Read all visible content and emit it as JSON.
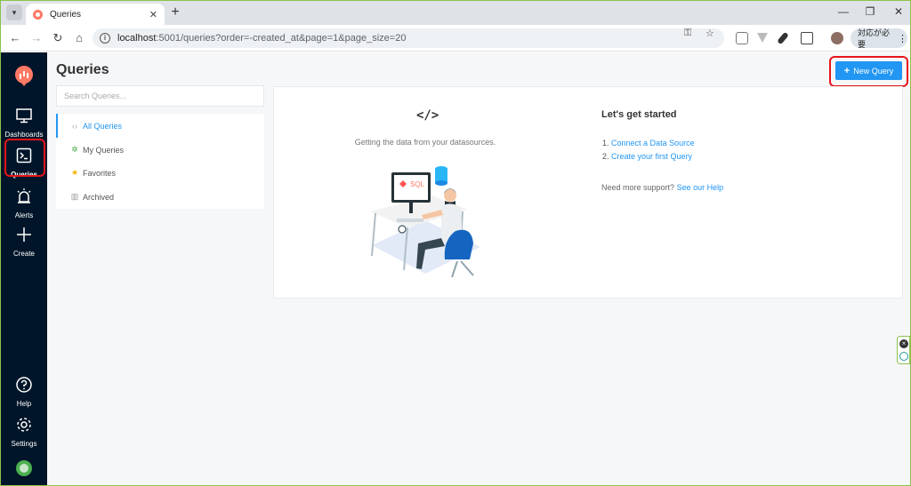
{
  "browser": {
    "tab_title": "Queries",
    "url_host": "localhost",
    "url_path": ":5001/queries?order=-created_at&page=1&page_size=20",
    "profile_label": "対応が必要"
  },
  "nav": {
    "items": [
      {
        "label": "Dashboards"
      },
      {
        "label": "Queries"
      },
      {
        "label": "Alerts"
      },
      {
        "label": "Create"
      },
      {
        "label": "Help"
      },
      {
        "label": "Settings"
      }
    ]
  },
  "header": {
    "title": "Queries",
    "new_query_label": "New Query"
  },
  "filters": {
    "search_placeholder": "Search Queries...",
    "items": [
      {
        "label": "All Queries",
        "icon": "code-icon",
        "active": true
      },
      {
        "label": "My Queries",
        "icon": "user-icon",
        "active": false
      },
      {
        "label": "Favorites",
        "icon": "star-icon",
        "active": false
      },
      {
        "label": "Archived",
        "icon": "archive-icon",
        "active": false
      }
    ]
  },
  "empty_state": {
    "icon_text": "</>",
    "description": "Getting the data from your datasources.",
    "illustration_text": "SQL",
    "title": "Let's get started",
    "step1_num": "1.",
    "step1": "Connect a Data Source",
    "step2_num": "2.",
    "step2": "Create your first Query",
    "support_text": "Need more support?",
    "support_link": "See our Help"
  },
  "colors": {
    "accent": "#2196f3",
    "nav_bg": "#001529",
    "highlight": "#e8141c",
    "logo": "#ff7964"
  }
}
